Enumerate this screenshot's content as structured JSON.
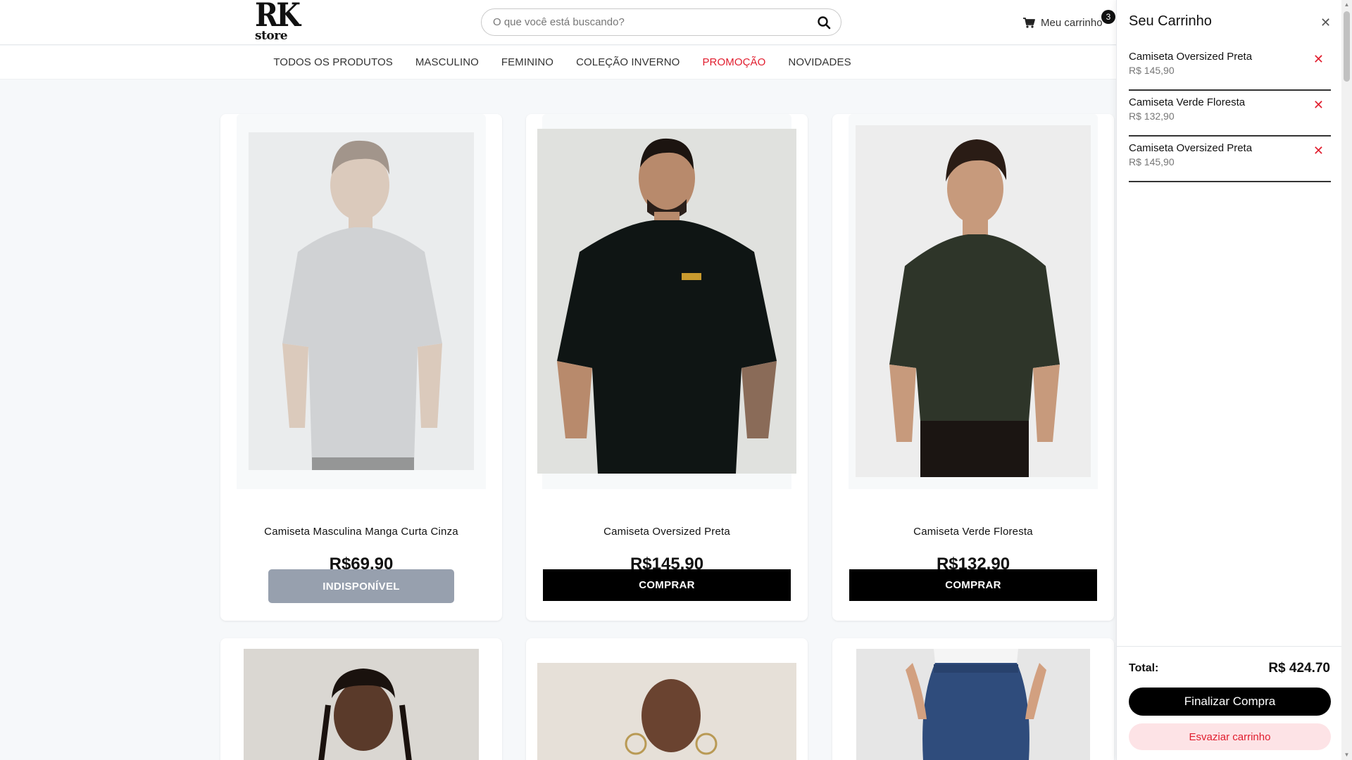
{
  "brand": {
    "logo_main": "RK",
    "logo_sub": "store"
  },
  "search": {
    "placeholder": "O que você está buscando?"
  },
  "header": {
    "cart_label": "Meu carrinho",
    "cart_count": "3"
  },
  "nav": {
    "items": [
      {
        "label": "TODOS OS PRODUTOS"
      },
      {
        "label": "MASCULINO"
      },
      {
        "label": "FEMININO"
      },
      {
        "label": "COLEÇÃO INVERNO"
      },
      {
        "label": "PROMOÇÃO"
      },
      {
        "label": "NOVIDADES"
      }
    ]
  },
  "products": [
    {
      "title": "Camiseta Masculina Manga Curta Cinza",
      "price": "R$69.90",
      "button": "INDISPONÍVEL",
      "available": false
    },
    {
      "title": "Camiseta Oversized Preta",
      "price": "R$145,90",
      "button": "COMPRAR",
      "available": true
    },
    {
      "title": "Camiseta Verde Floresta",
      "price": "R$132,90",
      "button": "COMPRAR",
      "available": true
    }
  ],
  "cart": {
    "title": "Seu Carrinho",
    "close_icon": "close-icon",
    "items": [
      {
        "name": "Camiseta Oversized Preta",
        "price": "R$ 145,90"
      },
      {
        "name": "Camiseta Verde Floresta",
        "price": "R$ 132,90"
      },
      {
        "name": "Camiseta Oversized Preta",
        "price": "R$ 145,90"
      }
    ],
    "total_label": "Total:",
    "total_value": "R$ 424.70",
    "checkout_label": "Finalizar Compra",
    "empty_label": "Esvaziar carrinho"
  },
  "colors": {
    "accent_red": "#e11d2e",
    "button_black": "#000000",
    "unavailable_gray": "#97a0ae",
    "page_bg": "#f6f8fa"
  }
}
